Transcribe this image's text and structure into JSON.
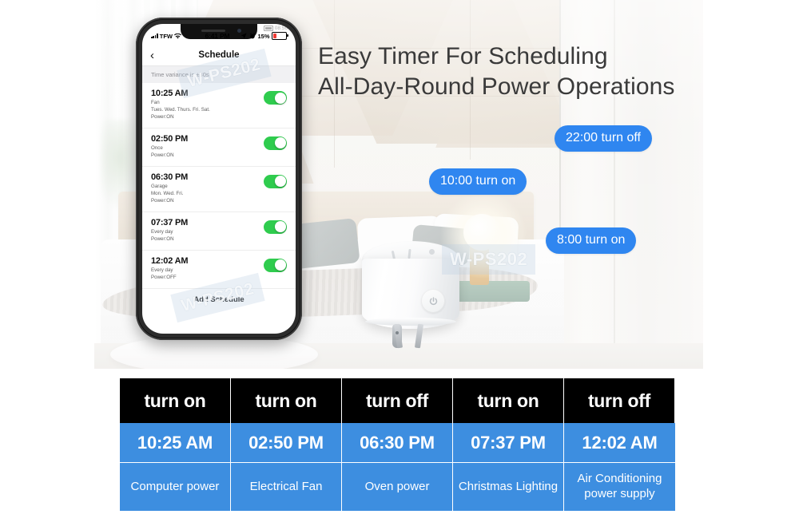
{
  "headline": {
    "line1": "Easy Timer For Scheduling",
    "line2": "All-Day-Round Power Operations"
  },
  "bubbles": [
    {
      "label": "22:00 turn off"
    },
    {
      "label": "10:00 turn on"
    },
    {
      "label": "8:00 turn on"
    }
  ],
  "phone": {
    "status_bar": {
      "carrier": "TFW",
      "time": "6:41 PM",
      "battery_percent": "15%",
      "ghost_time": "08:56"
    },
    "nav": {
      "back_icon": "chevron-left-icon",
      "title": "Schedule"
    },
    "hint": "Time variance is  ±30s",
    "schedules": [
      {
        "time": "10:25 AM",
        "name": "Fan",
        "days": "Tues. Wed. Thurs. Fri. Sat.",
        "power": "Power:ON",
        "enabled": "on"
      },
      {
        "time": "02:50 PM",
        "name": "Once",
        "days": "",
        "power": "Power:ON",
        "enabled": "on"
      },
      {
        "time": "06:30 PM",
        "name": "Garage",
        "days": "Mon. Wed. Fri.",
        "power": "Power:ON",
        "enabled": "on"
      },
      {
        "time": "07:37 PM",
        "name": "Every day",
        "days": "",
        "power": "Power:ON",
        "enabled": "on"
      },
      {
        "time": "12:02 AM",
        "name": "Every day",
        "days": "",
        "power": "Power:OFF",
        "enabled": "on"
      }
    ],
    "add_schedule": "Add Schedule"
  },
  "product": {
    "model": "W-PS202",
    "power_button_icon": "power-icon"
  },
  "watermarks": [
    {
      "text": "W-PS202"
    },
    {
      "text": "W-PS202"
    },
    {
      "text": "W-PS202"
    },
    {
      "text": "W-PS202"
    },
    {
      "text": "W-PS202"
    }
  ],
  "table": {
    "headers": [
      "turn on",
      "turn on",
      "turn off",
      "turn on",
      "turn off"
    ],
    "times": [
      "10:25 AM",
      "02:50 PM",
      "06:30 PM",
      "07:37 PM",
      "12:02 AM"
    ],
    "devices": [
      "Computer power",
      "Electrical Fan",
      "Oven power",
      "Christmas Lighting",
      "Air Conditioning power supply"
    ]
  },
  "colors": {
    "bubble_blue": "#2f86f0",
    "table_blue": "#3d8ee0",
    "header_black": "#000000",
    "toggle_green": "#2fcc4e",
    "battery_red": "#ef3b35",
    "headline_gray": "#3a3a3a"
  }
}
